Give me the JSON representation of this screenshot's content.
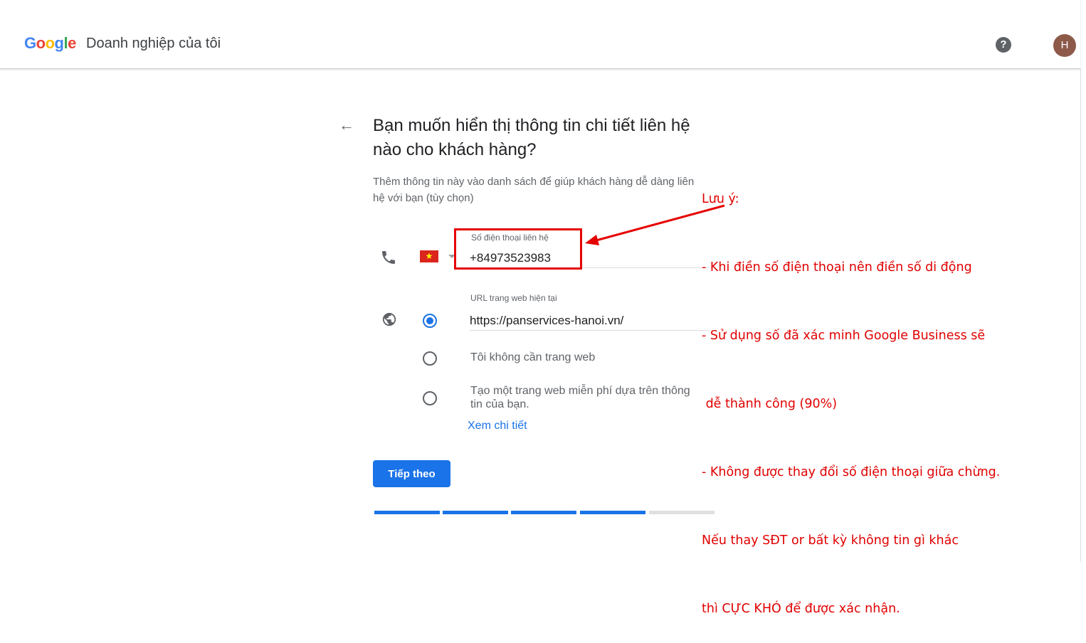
{
  "header": {
    "logo_letters": [
      {
        "ch": "G",
        "color": "#4285F4"
      },
      {
        "ch": "o",
        "color": "#EA4335"
      },
      {
        "ch": "o",
        "color": "#FBBC05"
      },
      {
        "ch": "g",
        "color": "#4285F4"
      },
      {
        "ch": "l",
        "color": "#34A853"
      },
      {
        "ch": "e",
        "color": "#EA4335"
      }
    ],
    "product_name": "Doanh nghiệp của tôi",
    "help_glyph": "?",
    "avatar_initial": "H"
  },
  "form": {
    "back_glyph": "←",
    "heading": "Bạn muốn hiển thị thông tin chi tiết liên hệ nào cho khách hàng?",
    "subtitle": "Thêm thông tin này vào danh sách để giúp khách hàng dễ dàng liên hệ với bạn (tùy chọn)",
    "phone": {
      "label": "Số điện thoại liên hệ",
      "value": "+84973523983",
      "flag_glyph": "★"
    },
    "website": {
      "label": "URL trang web hiện tại",
      "value": "https://panservices-hanoi.vn/",
      "options": [
        {
          "label": "Tôi không cần trang web",
          "checked": false
        },
        {
          "label": "Tạo một trang web miễn phí dựa trên thông tin của bạn.",
          "checked": false
        }
      ],
      "details_link": "Xem chi tiết"
    },
    "next_button": "Tiếp theo",
    "progress": {
      "completed_steps": 4,
      "total_steps": 5
    }
  },
  "colors": {
    "accent": "#1a73e8",
    "annotation": "#e00000"
  },
  "annotation": {
    "lines": [
      "Lưu ý:",
      "- Khi điền số điện thoại nên điền số di động",
      "- Sử dụng số đã xác minh Google Business sẽ",
      " dễ thành công (90%)",
      "- Không được thay đổi số điện thoại giữa chừng.",
      "Nếu thay SĐT or bất kỳ không tin gì khác",
      "thì CỰC KHÓ để được xác nhận."
    ]
  }
}
